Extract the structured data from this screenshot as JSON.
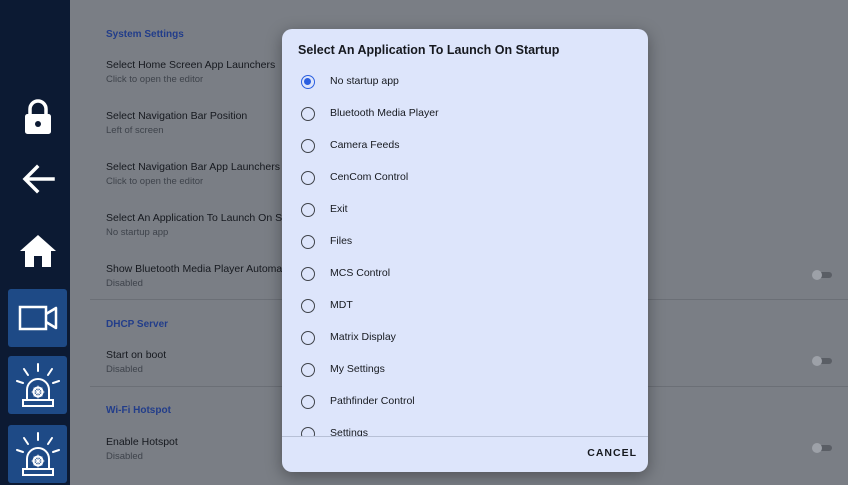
{
  "rail": {
    "items": [
      "lock-icon",
      "back-arrow-icon",
      "home-icon",
      "camera-icon",
      "emergency-light-icon",
      "emergency-light-icon"
    ]
  },
  "settings": {
    "system_section": "System Settings",
    "home_launchers": {
      "title": "Select Home Screen App Launchers",
      "subtitle": "Click to open the editor"
    },
    "nav_position": {
      "title": "Select Navigation Bar Position",
      "subtitle": "Left of screen"
    },
    "nav_launchers": {
      "title": "Select Navigation Bar App Launchers",
      "subtitle": "Click to open the editor"
    },
    "startup_app": {
      "title": "Select An Application To Launch On S",
      "subtitle": "No startup app"
    },
    "bt_auto": {
      "title": "Show Bluetooth Media Player Automa",
      "subtitle": "Disabled"
    },
    "dhcp_section": "DHCP Server",
    "start_on_boot": {
      "title": "Start on boot",
      "subtitle": "Disabled"
    },
    "wifi_section": "Wi-Fi Hotspot",
    "enable_hotspot": {
      "title": "Enable Hotspot",
      "subtitle": "Disabled"
    }
  },
  "dialog": {
    "title": "Select An Application To Launch On Startup",
    "selected": "No startup app",
    "options": [
      "No startup app",
      "Bluetooth Media Player",
      "Camera Feeds",
      "CenCom Control",
      "Exit",
      "Files",
      "MCS Control",
      "MDT",
      "Matrix Display",
      "My Settings",
      "Pathfinder Control",
      "Settings"
    ],
    "cancel_label": "CANCEL"
  },
  "colors": {
    "rail_bg": "#0c1a33",
    "rail_active": "#1e4a86",
    "dialog_bg": "#dde5fb",
    "accent": "#2a5fe0",
    "section_text": "#223d8a"
  }
}
